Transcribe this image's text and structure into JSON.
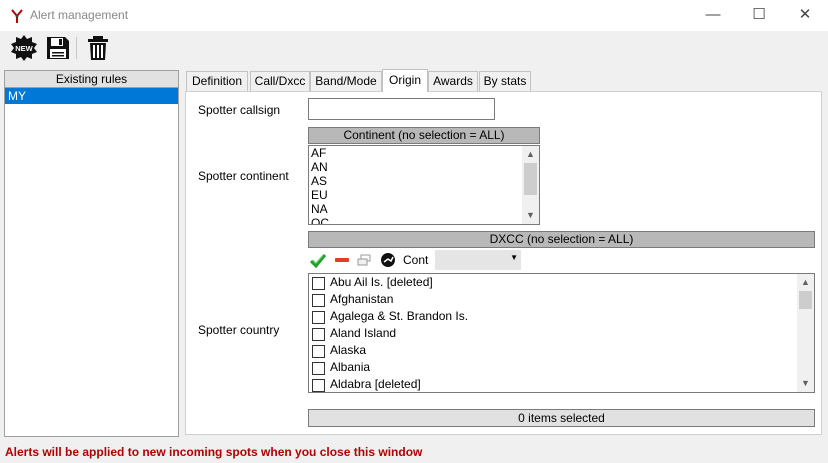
{
  "window": {
    "title": "Alert management",
    "controls": {
      "minimize": "—",
      "maximize": "☐",
      "close": "✕"
    }
  },
  "toolbar": {
    "new_badge": "NEW",
    "buttons": [
      {
        "icon": "new-icon"
      },
      {
        "icon": "save-icon"
      },
      {
        "icon": "trash-icon"
      }
    ]
  },
  "rules": {
    "header": "Existing rules",
    "items": [
      {
        "label": "MY",
        "selected": true
      }
    ]
  },
  "tabs": [
    {
      "label": "Definition",
      "active": false
    },
    {
      "label": "Call/Dxcc",
      "active": false
    },
    {
      "label": "Band/Mode",
      "active": false
    },
    {
      "label": "Origin",
      "active": true
    },
    {
      "label": "Awards",
      "active": false
    },
    {
      "label": "By stats",
      "active": false
    }
  ],
  "origin": {
    "spotter_callsign_label": "Spotter callsign",
    "spotter_callsign_value": "",
    "spotter_continent_label": "Spotter continent",
    "continent_header": "Continent (no selection = ALL)",
    "continents": [
      "AF",
      "AN",
      "AS",
      "EU",
      "NA",
      "OC"
    ],
    "dxcc_header": "DXCC (no selection = ALL)",
    "dxcc_toolbar": {
      "icons": [
        "check-all-icon",
        "uncheck-all-icon",
        "windows-icon",
        "globe-icon"
      ],
      "cont_label": "Cont",
      "cont_value": ""
    },
    "spotter_country_label": "Spotter country",
    "countries": [
      {
        "name": "Abu Ail Is. [deleted]",
        "checked": false
      },
      {
        "name": "Afghanistan",
        "checked": false
      },
      {
        "name": "Agalega & St. Brandon Is.",
        "checked": false
      },
      {
        "name": "Aland Island",
        "checked": false
      },
      {
        "name": "Alaska",
        "checked": false
      },
      {
        "name": "Albania",
        "checked": false
      },
      {
        "name": "Aldabra [deleted]",
        "checked": false
      }
    ],
    "selection_status": "0 items selected"
  },
  "footer": {
    "message": "Alerts will be applied to new incoming spots when you close this window"
  },
  "colors": {
    "selection": "#0078d7",
    "header_gray": "#b8b8b8",
    "warning_red": "#b00000",
    "check_green": "#22a22a"
  }
}
